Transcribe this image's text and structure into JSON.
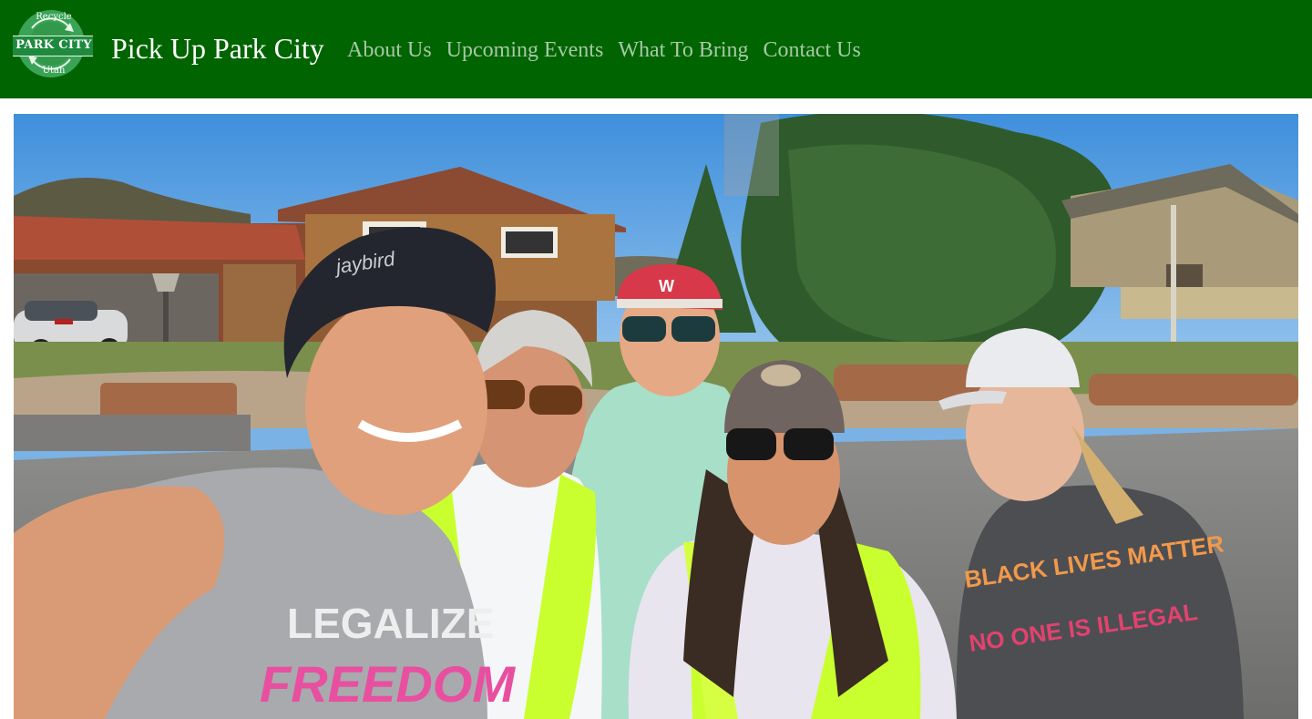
{
  "logo": {
    "top_text": "Recycle",
    "main_text": "PARK CITY",
    "bottom_text": "Utah",
    "icon": "recycle-icon"
  },
  "header": {
    "site_title": "Pick Up Park City"
  },
  "nav": {
    "items": [
      {
        "label": "About Us"
      },
      {
        "label": "Upcoming Events"
      },
      {
        "label": "What To Bring"
      },
      {
        "label": "Contact Us"
      }
    ]
  },
  "hero": {
    "shirt_text_1": "LEGALIZE",
    "shirt_text_2": "FREEDOM",
    "shirt_text_3": "BLACK LIVES MATTER",
    "shirt_text_4": "NO ONE IS ILLEGAL",
    "bandana_text": "jaybird",
    "hat_logo": "W"
  },
  "colors": {
    "header_bg": "#006400",
    "nav_link": "#a7c8a7",
    "title": "#ffffff",
    "logo_green": "#3aa356"
  }
}
